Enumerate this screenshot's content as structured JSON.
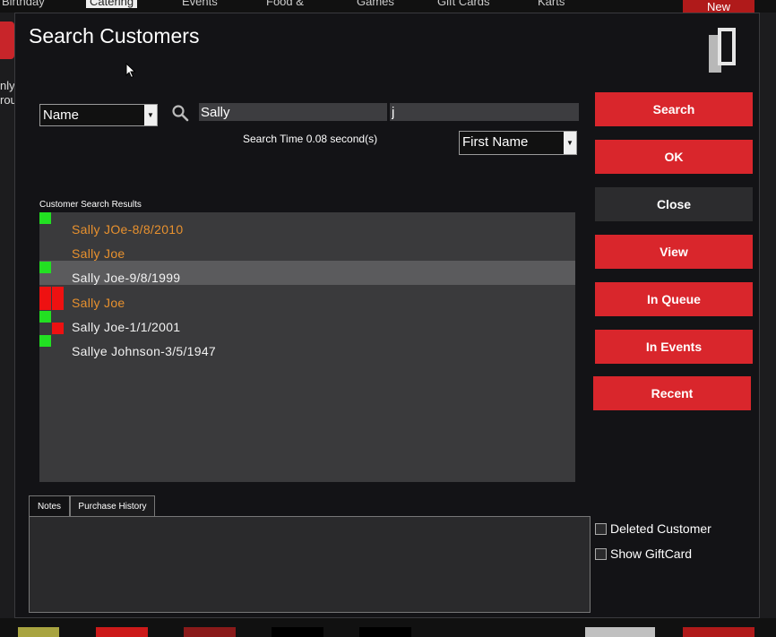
{
  "background": {
    "tabs": [
      "Birthday",
      "Catering",
      "Events",
      "Food &",
      "Games",
      "Gift Cards",
      "Karts"
    ],
    "new_label": "New",
    "left_text": [
      "nly",
      "rou"
    ]
  },
  "dialog": {
    "title": "Search Customers",
    "search_type": {
      "value": "Name"
    },
    "search_input_1": {
      "value": "Sally"
    },
    "search_input_2": {
      "value": "j"
    },
    "search_time": "Search Time 0.08 second(s)",
    "field_select": {
      "value": "First Name"
    },
    "buttons": {
      "search": "Search",
      "ok": "OK",
      "close": "Close",
      "view": "View",
      "in_queue": "In Queue",
      "in_events": "In Events",
      "recent": "Recent"
    },
    "results_label": "Customer Search Results",
    "results": [
      {
        "text": "Sally JOe-8/8/2010",
        "color": "orange",
        "selected": false
      },
      {
        "text": "Sally Joe",
        "color": "orange",
        "selected": false
      },
      {
        "text": "Sally  Joe-9/8/1999",
        "color": "white",
        "selected": true
      },
      {
        "text": "Sally Joe",
        "color": "orange",
        "selected": false
      },
      {
        "text": "Sally  Joe-1/1/2001",
        "color": "white",
        "selected": false
      },
      {
        "text": "Sallye Johnson-3/5/1947",
        "color": "white",
        "selected": false
      }
    ],
    "tabs": {
      "notes": "Notes",
      "purchase_history": "Purchase History"
    },
    "checkboxes": {
      "deleted_customer": {
        "label": "Deleted Customer",
        "checked": false
      },
      "show_giftcard": {
        "label": "Show GiftCard",
        "checked": false
      }
    },
    "colors": {
      "accent_red": "#d9262c",
      "orange_text": "#e8912e",
      "green_marker": "#22e022",
      "red_marker": "#ee1111"
    }
  }
}
